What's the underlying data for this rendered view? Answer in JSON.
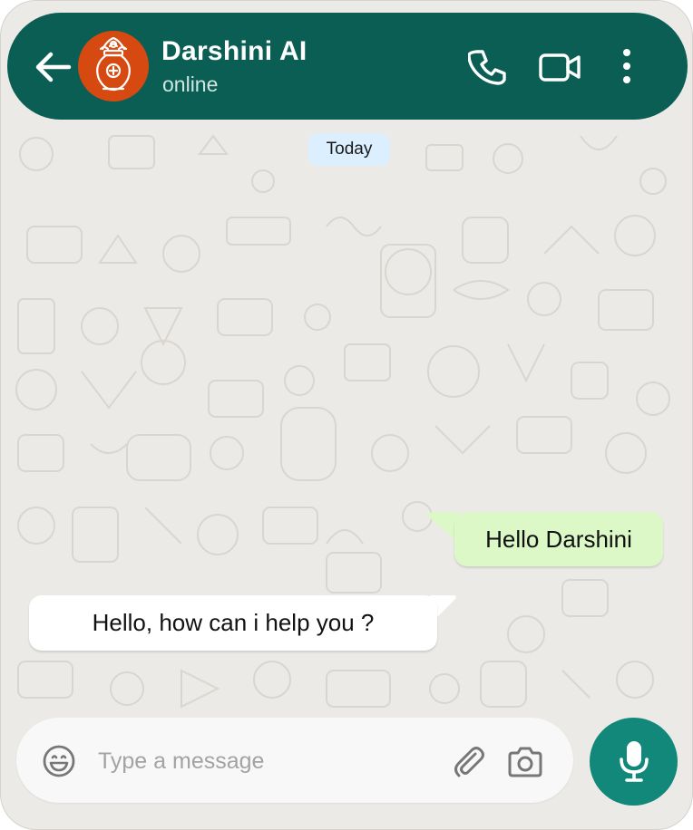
{
  "header": {
    "title": "Darshini AI",
    "status": "online",
    "icons": [
      "back-arrow-icon",
      "kalash-avatar",
      "phone-icon",
      "video-camera-icon",
      "more-vert-icon"
    ]
  },
  "chat": {
    "date_chip": "Today",
    "messages": [
      {
        "direction": "outgoing",
        "text": "Hello Darshini"
      },
      {
        "direction": "incoming",
        "text": "Hello, how can i help you ?"
      }
    ]
  },
  "composer": {
    "placeholder": "Type a message",
    "value": "",
    "icons": [
      "emoji-icon",
      "paperclip-icon",
      "camera-icon",
      "microphone-icon"
    ]
  },
  "colors": {
    "header_bg": "#0b5e54",
    "chat_bg": "#eceae7",
    "outgoing_bubble": "#dcf8c6",
    "incoming_bubble": "#ffffff",
    "date_chip_bg": "#dcefff",
    "mic_button": "#11887a",
    "avatar_bg": "#d64a12"
  }
}
